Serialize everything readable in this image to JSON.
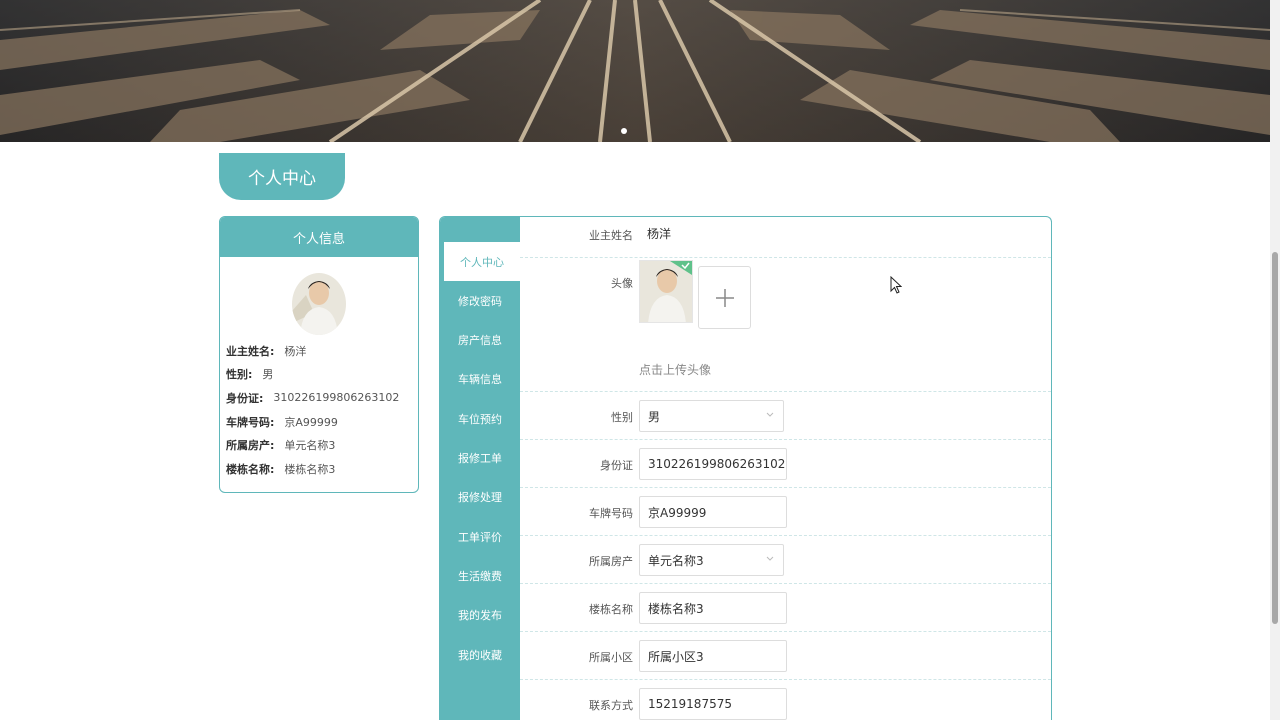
{
  "page": {
    "title": "个人中心"
  },
  "info_card": {
    "header": "个人信息",
    "rows": [
      {
        "label": "业主姓名:",
        "value": "杨洋"
      },
      {
        "label": "性别:",
        "value": "男"
      },
      {
        "label": "身份证:",
        "value": "310226199806263102"
      },
      {
        "label": "车牌号码:",
        "value": "京A99999"
      },
      {
        "label": "所属房产:",
        "value": "单元名称3"
      },
      {
        "label": "楼栋名称:",
        "value": "楼栋名称3"
      }
    ]
  },
  "sidebar": {
    "items": [
      {
        "label": "个人中心"
      },
      {
        "label": "修改密码"
      },
      {
        "label": "房产信息"
      },
      {
        "label": "车辆信息"
      },
      {
        "label": "车位预约"
      },
      {
        "label": "报修工单"
      },
      {
        "label": "报修处理"
      },
      {
        "label": "工单评价"
      },
      {
        "label": "生活缴费"
      },
      {
        "label": "我的发布"
      },
      {
        "label": "我的收藏"
      }
    ]
  },
  "form": {
    "owner_name": {
      "label": "业主姓名",
      "value": "杨洋"
    },
    "avatar": {
      "label": "头像",
      "hint": "点击上传头像"
    },
    "gender": {
      "label": "性别",
      "value": "男"
    },
    "id_card": {
      "label": "身份证",
      "value": "310226199806263102"
    },
    "plate": {
      "label": "车牌号码",
      "value": "京A99999"
    },
    "property": {
      "label": "所属房产",
      "value": "单元名称3"
    },
    "building": {
      "label": "楼栋名称",
      "value": "楼栋名称3"
    },
    "community": {
      "label": "所属小区",
      "value": "所属小区3"
    },
    "contact": {
      "label": "联系方式",
      "value": "15219187575"
    }
  },
  "colors": {
    "accent": "#5fb7ba"
  }
}
